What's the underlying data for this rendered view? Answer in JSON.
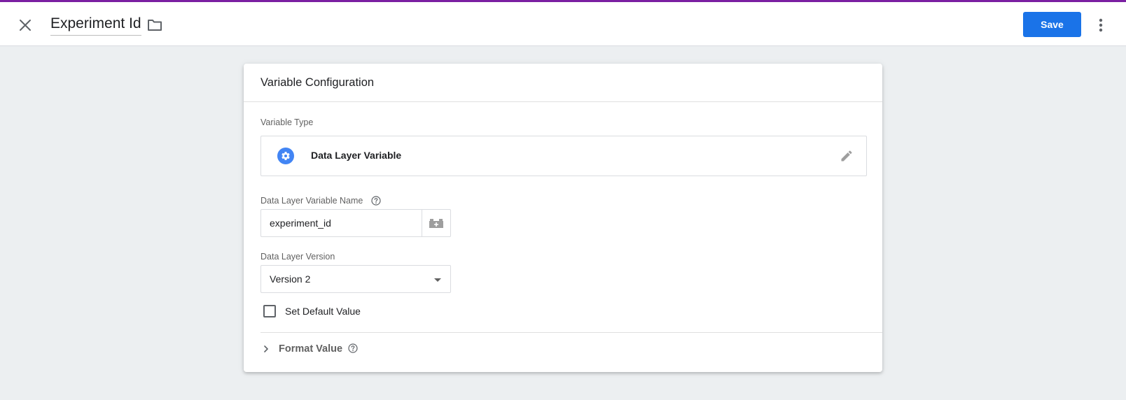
{
  "header": {
    "title": "Experiment Id",
    "save_label": "Save",
    "icons": {
      "close": "close-icon",
      "folder": "folder-icon",
      "more": "more-vert-icon"
    }
  },
  "card": {
    "title": "Variable Configuration",
    "variable_type": {
      "label": "Variable Type",
      "value": "Data Layer Variable",
      "icon": "gear-icon"
    },
    "variable_name": {
      "label": "Data Layer Variable Name",
      "value": "experiment_id"
    },
    "version": {
      "label": "Data Layer Version",
      "selected": "Version 2"
    },
    "default_value": {
      "label": "Set Default Value",
      "checked": false
    },
    "format_value": {
      "label": "Format Value"
    }
  },
  "colors": {
    "accent": "#7b1fa2",
    "primary": "#1a73e8",
    "type_icon": "#4285f4"
  }
}
